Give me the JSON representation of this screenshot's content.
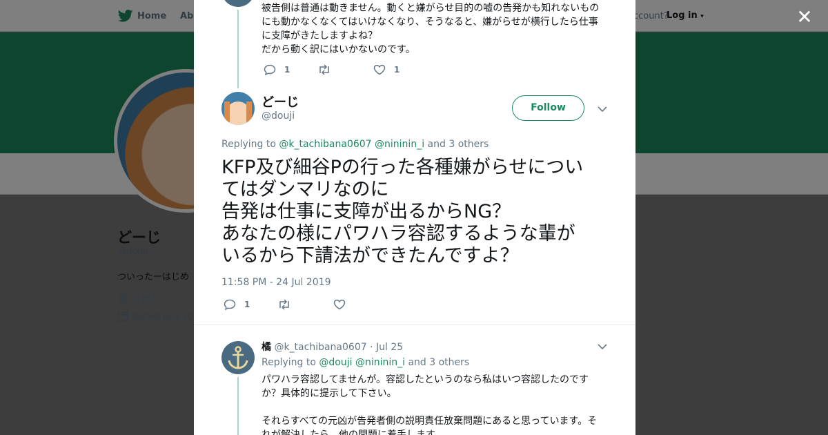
{
  "nav": {
    "home_label": "Home",
    "about_label": "Abo",
    "account_prompt": "ccount?",
    "login_label": "Log in"
  },
  "profile": {
    "name": "どーじ",
    "handle": "@douji",
    "bio": "ついったーはじめ",
    "location": "にほん",
    "joined": "Joined July 20"
  },
  "modal": {
    "prev_tweet": {
      "lines": [
        "被告側は普通は動きません。動くと嫌がらせ目的の嘘の告発かも知れないもの",
        "にも動かなくなくてはいけなくなり、そうなると、嫌がらせが横行したら仕事",
        "に支障がきたしますよね？",
        "だから動く訳にはいかないのです。"
      ],
      "reply_count": "1",
      "like_count": "1"
    },
    "main_tweet": {
      "name": "どーじ",
      "handle": "@douji",
      "follow_label": "Follow",
      "replying_prefix": "Replying to",
      "mention_1": "@k_tachibana0607",
      "mention_2": "@nininin_i",
      "replying_suffix": "and 3 others",
      "text_lines": [
        "KFP及び細谷Pの行った各種嫌がらせについ",
        "てはダンマリなのに",
        "告発は仕事に支障が出るからNG？",
        "あなたの様にパワハラ容認するような輩が",
        "いるから下請法ができたんですよ？"
      ],
      "timestamp": "11:58 PM - 24 Jul 2019",
      "reply_count": "1"
    },
    "reply_tweet": {
      "name": "橘",
      "handle": "@k_tachibana0607",
      "date": "· Jul 25",
      "replying_prefix": "Replying to",
      "mention_1": "@douji",
      "mention_2": "@nininin_i",
      "replying_suffix": "and 3 others",
      "text_lines": [
        "パワハラ容認してませんが。容認したというのなら私はいつ容認したのです",
        "か？具体的に提示して下さい。",
        "",
        "それらすべての元凶が告発者側の説明責任放棄問題にあると思っています。そ",
        "れが解決したら、他の問題に着手します。"
      ]
    }
  },
  "colors": {
    "accent": "#1b8a5e",
    "banner": "#1b8a5e",
    "thread_line": "#a8d8c0",
    "muted_text": "#657786"
  }
}
